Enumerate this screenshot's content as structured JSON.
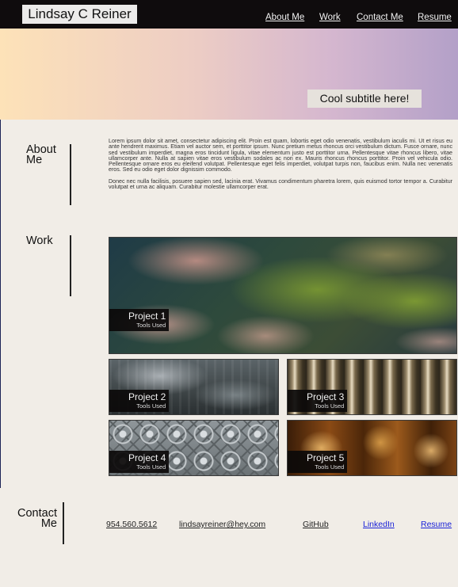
{
  "brand": {
    "name": "Lindsay C Reiner"
  },
  "nav": {
    "items": [
      "About Me",
      "Work",
      "Contact Me",
      "Resume"
    ]
  },
  "hero": {
    "subtitle": "Cool subtitle here!"
  },
  "about": {
    "title": "About Me",
    "paragraph1": "Lorem ipsum dolor sit amet, consectetur adipiscing elit. Proin est quam, lobortis eget odio venenatis, vestibulum iaculis mi. Ut et risus eu ante hendrerit maximus. Etiam vel auctor sem, et porttitor ipsum. Nunc pretium metus rhoncus orci vestibulum dictum. Fusce ornare, nunc sed vestibulum imperdiet, magna eros tincidunt ligula, vitae elementum justo est porttitor urna. Pellentesque vitae rhoncus libero, vitae ullamcorper ante. Nulla at sapien vitae eros vestibulum sodales ac non ex. Mauris rhoncus rhoncus porttitor. Proin vel vehicula odio. Pellentesque ornare eros eu eleifend volutpat. Pellentesque eget felis imperdiet, volutpat turpis non, faucibus enim. Nulla nec venenatis eros. Sed eu odio eget dolor dignissim commodo.",
    "paragraph2": "Donec nec nulla facilisis, posuere sapien sed, lacinia erat. Vivamus condimentum pharetra lorem, quis euismod tortor tempor a. Curabitur volutpat et urna ac aliquam. Curabitur molestie ullamcorper erat."
  },
  "work": {
    "title": "Work",
    "projects": [
      {
        "name": "Project 1",
        "tools": "Tools Used"
      },
      {
        "name": "Project 2",
        "tools": "Tools Used"
      },
      {
        "name": "Project 3",
        "tools": "Tools Used"
      },
      {
        "name": "Project 4",
        "tools": "Tools Used"
      },
      {
        "name": "Project 5",
        "tools": "Tools Used"
      }
    ]
  },
  "contact": {
    "title": "Contact Me",
    "phone": "954.560.5612",
    "email": "lindsayreiner@hey.com",
    "github": "GitHub",
    "linkedin": "LinkedIn",
    "resume": "Resume"
  },
  "colors": {
    "header_bg": "#0f0c0d",
    "page_bg": "#f1ede7",
    "hero_gradient": [
      "#fde2b8",
      "#edcdc4",
      "#d5b7cf",
      "#b3a0c8"
    ],
    "link_blue": "#1a22d8"
  }
}
